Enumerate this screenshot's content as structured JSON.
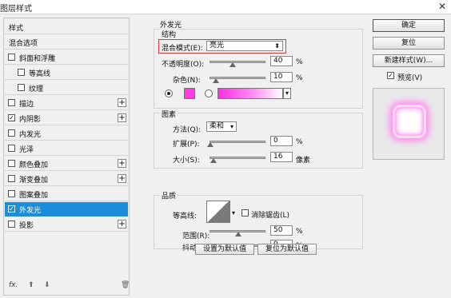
{
  "window": {
    "title": "图层样式"
  },
  "left": {
    "items": [
      {
        "label": "样式",
        "checkbox": false,
        "checked": false,
        "indent": false,
        "plus": false,
        "selected": false
      },
      {
        "label": "混合选项",
        "checkbox": false,
        "checked": false,
        "indent": false,
        "plus": false,
        "selected": false
      },
      {
        "label": "斜面和浮雕",
        "checkbox": true,
        "checked": false,
        "indent": false,
        "plus": false,
        "selected": false
      },
      {
        "label": "等高线",
        "checkbox": true,
        "checked": false,
        "indent": true,
        "plus": false,
        "selected": false
      },
      {
        "label": "纹理",
        "checkbox": true,
        "checked": false,
        "indent": true,
        "plus": false,
        "selected": false
      },
      {
        "label": "描边",
        "checkbox": true,
        "checked": false,
        "indent": false,
        "plus": true,
        "selected": false
      },
      {
        "label": "内阴影",
        "checkbox": true,
        "checked": true,
        "indent": false,
        "plus": true,
        "selected": false
      },
      {
        "label": "内发光",
        "checkbox": true,
        "checked": false,
        "indent": false,
        "plus": false,
        "selected": false
      },
      {
        "label": "光泽",
        "checkbox": true,
        "checked": false,
        "indent": false,
        "plus": false,
        "selected": false
      },
      {
        "label": "颜色叠加",
        "checkbox": true,
        "checked": false,
        "indent": false,
        "plus": true,
        "selected": false
      },
      {
        "label": "渐变叠加",
        "checkbox": true,
        "checked": false,
        "indent": false,
        "plus": true,
        "selected": false
      },
      {
        "label": "图案叠加",
        "checkbox": true,
        "checked": false,
        "indent": false,
        "plus": false,
        "selected": false
      },
      {
        "label": "外发光",
        "checkbox": true,
        "checked": true,
        "indent": false,
        "plus": false,
        "selected": true
      },
      {
        "label": "投影",
        "checkbox": true,
        "checked": false,
        "indent": false,
        "plus": true,
        "selected": false
      }
    ],
    "footer": {
      "fx": "fx.",
      "up": "⬆",
      "down": "⬇",
      "trash": "🗑"
    }
  },
  "main": {
    "section_title": "外发光",
    "structure": {
      "title": "结构",
      "blend_label": "混合模式(E):",
      "blend_value": "亮光",
      "opacity_label": "不透明度(O):",
      "opacity_value": "40",
      "opacity_level": 40,
      "noise_label": "杂色(N):",
      "noise_value": "10",
      "noise_level": 10,
      "unit": "%",
      "swatch_color": "#ff3ddf"
    },
    "elements": {
      "title": "图素",
      "method_label": "方法(Q):",
      "method_value": "柔和",
      "spread_label": "扩展(P):",
      "spread_value": "0",
      "spread_level": 0,
      "size_label": "大小(S):",
      "size_value": "16",
      "size_level": 6,
      "size_unit": "像素",
      "unit": "%"
    },
    "quality": {
      "title": "品质",
      "contour_label": "等高线:",
      "antialias_label": "消除锯齿(L)",
      "range_label": "范围(R):",
      "range_value": "50",
      "range_level": 50,
      "jitter_label": "抖动(J):",
      "jitter_value": "0",
      "jitter_level": 0,
      "unit": "%"
    },
    "buttons": {
      "make_default": "设置为默认值",
      "reset_default": "复位为默认值"
    }
  },
  "right": {
    "ok": "确定",
    "reset": "复位",
    "new_style": "新建样式(W)...",
    "preview_label": "预览(V)",
    "preview_checked": true
  },
  "colors": {
    "accent": "#1c8dd9",
    "glow": "#ff8cef",
    "highlight_box": "#e0393c"
  }
}
